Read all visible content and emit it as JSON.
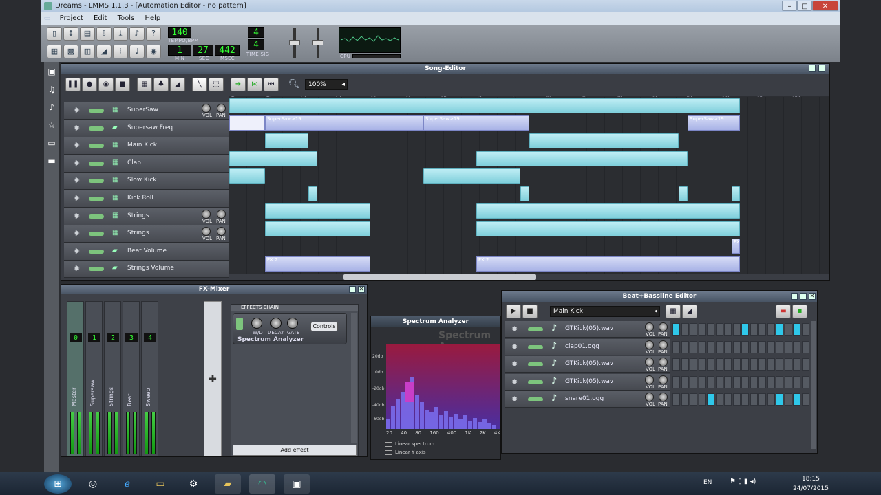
{
  "window": {
    "title": "Dreams - LMMS 1.1.3 - [Automation Editor - no pattern]"
  },
  "menu": [
    "Project",
    "Edit",
    "Tools",
    "Help"
  ],
  "transport": {
    "tempo": "140",
    "tempo_label": "TEMPO/BPM",
    "min": "1",
    "sec": "27",
    "msec": "442",
    "min_label": "MIN",
    "sec_label": "SEC",
    "msec_label": "MSEC",
    "timesig_top": "4",
    "timesig_bottom": "4",
    "timesig_label": "TIME SIG",
    "cpu_label": "CPU"
  },
  "song_editor": {
    "title": "Song-Editor",
    "zoom": "100%",
    "ruler_marks": [
      "45",
      "49",
      "53",
      "57",
      "61",
      "65",
      "69",
      "73",
      "77",
      "81",
      "85",
      "89",
      "93",
      "97",
      "101",
      "105",
      "109"
    ],
    "tracks": [
      {
        "name": "SuperSaw",
        "knobs": true
      },
      {
        "name": "Supersaw Freq",
        "knobs": false
      },
      {
        "name": "Main Kick",
        "knobs": false
      },
      {
        "name": "Clap",
        "knobs": false
      },
      {
        "name": "Slow Kick",
        "knobs": false
      },
      {
        "name": "Kick Roll",
        "knobs": false
      },
      {
        "name": "Strings",
        "knobs": true
      },
      {
        "name": "Strings",
        "knobs": true
      },
      {
        "name": "Beat Volume",
        "knobs": false
      },
      {
        "name": "Strings Volume",
        "knobs": false
      }
    ],
    "knob_labels": {
      "vol": "VOL",
      "pan": "PAN"
    },
    "auto_labels": {
      "supersaw1": "SuperSaw>19",
      "supersaw2": "SuperSaw>19",
      "supersaw3": "SuperSaw>19",
      "fx1": "FX 2",
      "fx2": "FX 2",
      "fx3": "FX"
    }
  },
  "fx_mixer": {
    "title": "FX-Mixer",
    "channels": [
      {
        "num": "0",
        "name": "Master"
      },
      {
        "num": "1",
        "name": "Supersaw"
      },
      {
        "num": "2",
        "name": "Strings"
      },
      {
        "num": "3",
        "name": "Beat"
      },
      {
        "num": "4",
        "name": "Sweep"
      }
    ],
    "effects_chain": "EFFECTS CHAIN",
    "effect_name": "Spectrum Analyzer",
    "wd": "W/D",
    "decay": "DECAY",
    "gate": "GATE",
    "controls": "Controls",
    "add_effect": "Add effect"
  },
  "spectrum": {
    "title": "Spectrum Analyzer",
    "watermark": "Spectrum Ana",
    "db_labels": [
      "20db",
      "0db",
      "-20db",
      "-40db",
      "-60db"
    ],
    "freq_labels": [
      "20",
      "40",
      "80",
      "160",
      "400",
      "1K",
      "2K",
      "4K"
    ],
    "opt1": "Linear spectrum",
    "opt2": "Linear Y axis"
  },
  "bb_editor": {
    "title": "Beat+Bassline Editor",
    "selected": "Main Kick",
    "rows": [
      {
        "name": "GTKick(05).wav",
        "steps": [
          1,
          0,
          0,
          0,
          0,
          0,
          0,
          0,
          1,
          0,
          0,
          0,
          1,
          0,
          1,
          0
        ]
      },
      {
        "name": "clap01.ogg",
        "steps": [
          0,
          0,
          0,
          0,
          0,
          0,
          0,
          0,
          0,
          0,
          0,
          0,
          0,
          0,
          0,
          0
        ]
      },
      {
        "name": "GTKick(05).wav",
        "steps": [
          0,
          0,
          0,
          0,
          0,
          0,
          0,
          0,
          0,
          0,
          0,
          0,
          0,
          0,
          0,
          0
        ]
      },
      {
        "name": "GTKick(05).wav",
        "steps": [
          0,
          0,
          0,
          0,
          0,
          0,
          0,
          0,
          0,
          0,
          0,
          0,
          0,
          0,
          0,
          0
        ]
      },
      {
        "name": "snare01.ogg",
        "steps": [
          0,
          0,
          0,
          0,
          1,
          0,
          0,
          0,
          0,
          0,
          0,
          0,
          1,
          0,
          1,
          0
        ]
      }
    ]
  },
  "taskbar": {
    "lang": "EN",
    "time": "18:15",
    "date": "24/07/2015"
  }
}
